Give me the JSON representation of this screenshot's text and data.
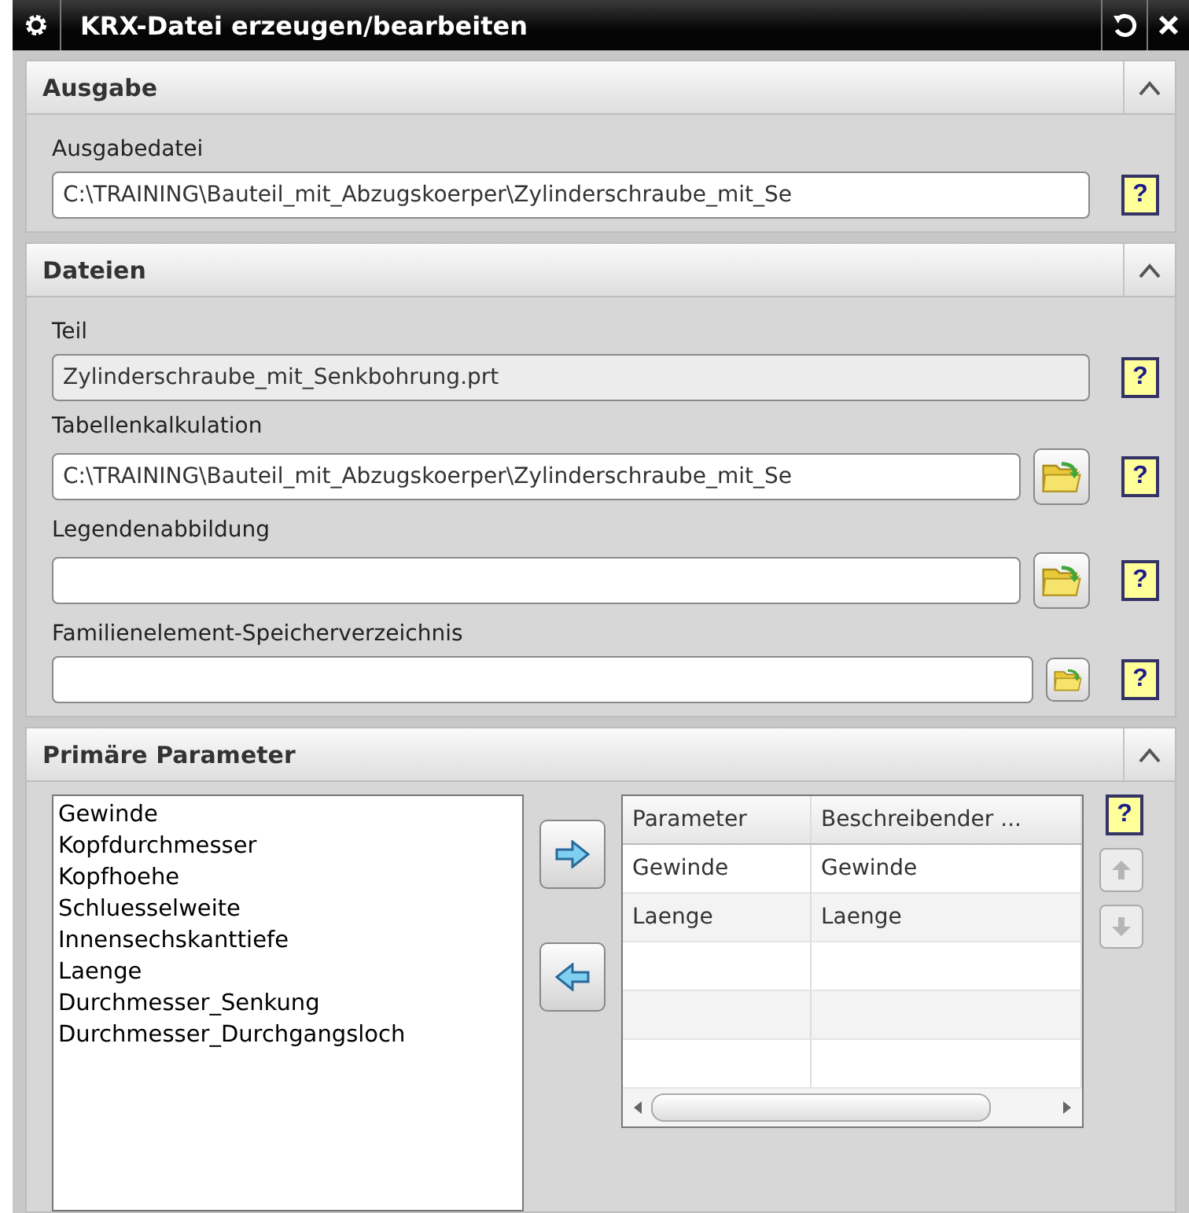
{
  "window": {
    "title": "KRX-Datei erzeugen/bearbeiten"
  },
  "sections": [
    {
      "title": "Ausgabe",
      "expanded": true,
      "fields": [
        {
          "label": "Ausgabedatei",
          "value": "C:\\TRAINING\\Bauteil_mit_Abzugskoerper\\Zylinderschraube_mit_Se",
          "readonly": false,
          "kind": "plain",
          "help": "?"
        }
      ]
    },
    {
      "title": "Dateien",
      "expanded": true,
      "fields": [
        {
          "label": "Teil",
          "value": "Zylinderschraube_mit_Senkbohrung.prt",
          "readonly": true,
          "kind": "plain",
          "help": "?"
        },
        {
          "label": "Tabellenkalkulation",
          "value": "C:\\TRAINING\\Bauteil_mit_Abzugskoerper\\Zylinderschraube_mit_Se",
          "readonly": false,
          "kind": "browse",
          "help": "?"
        },
        {
          "label": "Legendenabbildung",
          "readonly": false,
          "kind": "browse",
          "help": "?"
        },
        {
          "label": "Familienelement-Speicherverzeichnis",
          "readonly": false,
          "kind": "compact",
          "help": "?"
        }
      ]
    }
  ],
  "parameters": {
    "title": "Primäre Parameter",
    "expanded": true,
    "available": [
      "Gewinde",
      "Kopfdurchmesser",
      "Kopfhoehe",
      "Schluesselweite",
      "Innensechskanttiefe",
      "Laenge",
      "Durchmesser_Senkung",
      "Durchmesser_Durchgangsloch"
    ],
    "table": {
      "columns": [
        "Parameter",
        "Beschreibender ..."
      ],
      "rows": [
        [
          "Gewinde",
          "Gewinde"
        ],
        [
          "Laenge",
          "Laenge"
        ]
      ]
    },
    "help": "?",
    "move_up": {
      "disabled": true
    },
    "move_down": {
      "disabled": true
    }
  }
}
